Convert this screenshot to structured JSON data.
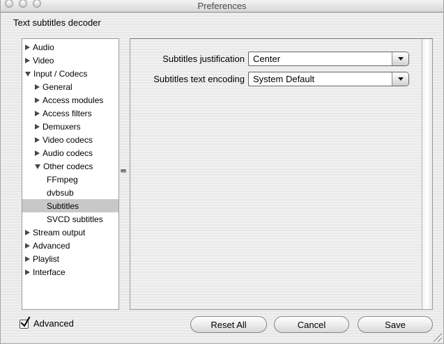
{
  "window": {
    "title": "Preferences",
    "page_title": "Text subtitles decoder"
  },
  "traffic_lights": [
    "close",
    "minimize",
    "zoom"
  ],
  "tree": {
    "items": [
      {
        "label": "Audio",
        "level": 1,
        "state": "collapsed",
        "selected": false
      },
      {
        "label": "Video",
        "level": 1,
        "state": "collapsed",
        "selected": false
      },
      {
        "label": "Input / Codecs",
        "level": 1,
        "state": "expanded",
        "selected": false
      },
      {
        "label": "General",
        "level": 2,
        "state": "collapsed",
        "selected": false
      },
      {
        "label": "Access modules",
        "level": 2,
        "state": "collapsed",
        "selected": false
      },
      {
        "label": "Access filters",
        "level": 2,
        "state": "collapsed",
        "selected": false
      },
      {
        "label": "Demuxers",
        "level": 2,
        "state": "collapsed",
        "selected": false
      },
      {
        "label": "Video codecs",
        "level": 2,
        "state": "collapsed",
        "selected": false
      },
      {
        "label": "Audio codecs",
        "level": 2,
        "state": "collapsed",
        "selected": false
      },
      {
        "label": "Other codecs",
        "level": 2,
        "state": "expanded",
        "selected": false
      },
      {
        "label": "FFmpeg",
        "level": 3,
        "state": "leaf",
        "selected": false
      },
      {
        "label": "dvbsub",
        "level": 3,
        "state": "leaf",
        "selected": false
      },
      {
        "label": "Subtitles",
        "level": 3,
        "state": "leaf",
        "selected": true
      },
      {
        "label": "SVCD subtitles",
        "level": 3,
        "state": "leaf",
        "selected": false
      },
      {
        "label": "Stream output",
        "level": 1,
        "state": "collapsed",
        "selected": false
      },
      {
        "label": "Advanced",
        "level": 1,
        "state": "collapsed",
        "selected": false
      },
      {
        "label": "Playlist",
        "level": 1,
        "state": "collapsed",
        "selected": false
      },
      {
        "label": "Interface",
        "level": 1,
        "state": "collapsed",
        "selected": false
      }
    ]
  },
  "form": {
    "fields": [
      {
        "label": "Subtitles justification",
        "value": "Center"
      },
      {
        "label": "Subtitles text encoding",
        "value": "System Default"
      }
    ]
  },
  "footer": {
    "advanced": {
      "label": "Advanced",
      "checked": true
    },
    "buttons": [
      {
        "label": "Reset All"
      },
      {
        "label": "Cancel"
      },
      {
        "label": "Save"
      }
    ]
  },
  "colors": {
    "selection": "#c8c8c8",
    "panel_border": "#9a9a9a",
    "window_bg": "#ececec",
    "titlebar_text": "#4a4a4a"
  }
}
